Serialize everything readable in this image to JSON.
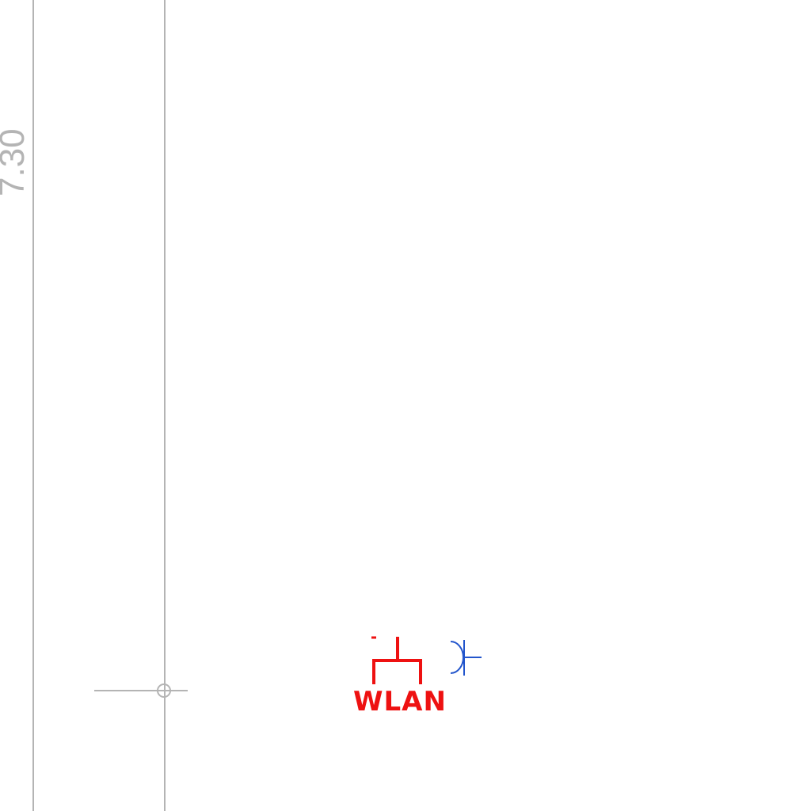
{
  "drawing": {
    "dimension_label": "7.30",
    "outlet_symbol": {
      "label": "WLAN",
      "icon": "wlan-outlet-icon",
      "color": "#ee1111"
    },
    "socket_symbol": {
      "icon": "socket-outlet-icon",
      "color": "#2255cc"
    },
    "line_color": "#b4b4b4"
  }
}
